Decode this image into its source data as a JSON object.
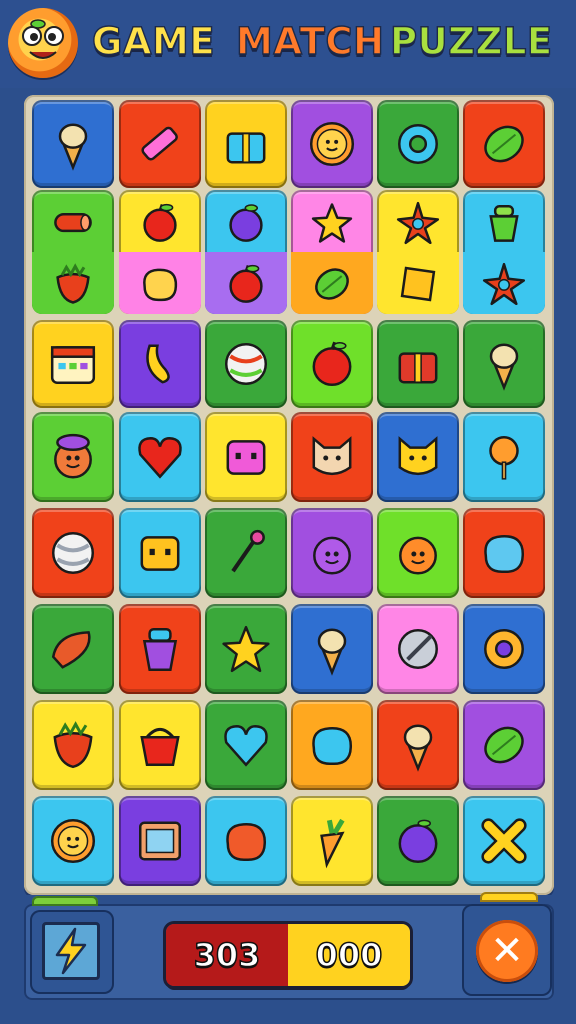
{
  "header": {
    "title_word_1": "GAME",
    "title_word_2": "MATCH",
    "title_word_3": "PUZZLE",
    "logo_icon": "smiling-sun-mascot-icon"
  },
  "board": {
    "columns": 6,
    "rows": [
      [
        {
          "color": "#2f6fd1",
          "icon": "ice-cream-cone-icon"
        },
        {
          "color": "#f0421a",
          "icon": "pencil-icon"
        },
        {
          "color": "#ffd21f",
          "icon": "gift-box-icon"
        },
        {
          "color": "#a14fe0",
          "icon": "sun-face-icon"
        },
        {
          "color": "#3aa83a",
          "icon": "donut-icon"
        },
        {
          "color": "#f0421a",
          "icon": "watermelon-icon"
        }
      ],
      [
        {
          "color": "#5ccf35",
          "split": "#5ccf35",
          "icon": "log-icon",
          "icon2": "strawberry-icon"
        },
        {
          "color": "#ffe52e",
          "split": "#ff82e6",
          "icon": "apple-icon",
          "icon2": "potato-icon"
        },
        {
          "color": "#3cc6ef",
          "split": "#a86df0",
          "icon": "plum-icon",
          "icon2": "apple-icon"
        },
        {
          "color": "#ff86e6",
          "split": "#ffa81f",
          "icon": "star-cookie-icon",
          "icon2": "leaf-icon"
        },
        {
          "color": "#ffe52e",
          "split": "#ffe52e",
          "icon": "starfish-icon",
          "icon2": "cracker-icon"
        },
        {
          "color": "#3cc6ef",
          "split": "#3cc6ef",
          "icon": "juicer-icon",
          "icon2": "spiky-fruit-icon"
        }
      ],
      [
        {
          "color": "#ffd21f",
          "icon": "calendar-icon"
        },
        {
          "color": "#7a3ee0",
          "icon": "banana-bunch-icon"
        },
        {
          "color": "#3aa83a",
          "icon": "ball-icon"
        },
        {
          "color": "#6fe02a",
          "icon": "apple-icon"
        },
        {
          "color": "#3aa83a",
          "icon": "present-icon"
        },
        {
          "color": "#3aa83a",
          "icon": "ice-cream-cone-icon"
        }
      ],
      [
        {
          "color": "#5ccf35",
          "icon": "chef-face-icon"
        },
        {
          "color": "#3cc6ef",
          "icon": "heart-icon"
        },
        {
          "color": "#ffe52e",
          "icon": "robot-face-icon"
        },
        {
          "color": "#f0421a",
          "icon": "cat-face-icon"
        },
        {
          "color": "#2f6fd1",
          "icon": "cat-face-icon"
        },
        {
          "color": "#3cc6ef",
          "icon": "lollipop-icon"
        }
      ],
      [
        {
          "color": "#f0421a",
          "icon": "beach-ball-icon"
        },
        {
          "color": "#3cc6ef",
          "icon": "robot-box-icon"
        },
        {
          "color": "#3aa83a",
          "icon": "flower-stem-icon"
        },
        {
          "color": "#a14fe0",
          "icon": "gear-face-icon"
        },
        {
          "color": "#6fe02a",
          "icon": "smiley-face-icon"
        },
        {
          "color": "#f0421a",
          "icon": "cloud-face-icon"
        }
      ],
      [
        {
          "color": "#3aa83a",
          "icon": "chili-pepper-icon"
        },
        {
          "color": "#f0421a",
          "icon": "cup-icon"
        },
        {
          "color": "#3aa83a",
          "icon": "star-icon"
        },
        {
          "color": "#2f6fd1",
          "icon": "ice-cream-cone-icon"
        },
        {
          "color": "#ff86e6",
          "icon": "compass-icon"
        },
        {
          "color": "#2f6fd1",
          "icon": "ring-icon"
        }
      ],
      [
        {
          "color": "#ffe52e",
          "icon": "strawberry-face-icon"
        },
        {
          "color": "#ffe52e",
          "icon": "basket-icon"
        },
        {
          "color": "#3aa83a",
          "icon": "heart-icon"
        },
        {
          "color": "#ffa81f",
          "icon": "blob-face-icon"
        },
        {
          "color": "#f0421a",
          "icon": "ice-cream-cone-icon"
        },
        {
          "color": "#a14fe0",
          "icon": "leaf-icon"
        }
      ],
      [
        {
          "color": "#3cc6ef",
          "icon": "sun-face-icon"
        },
        {
          "color": "#7a3ee0",
          "icon": "picture-frame-icon"
        },
        {
          "color": "#3cc6ef",
          "icon": "candy-blob-icon"
        },
        {
          "color": "#ffe52e",
          "icon": "carrot-icon"
        },
        {
          "color": "#3aa83a",
          "icon": "plum-icon"
        },
        {
          "color": "#3cc6ef",
          "icon": "x-cross-icon"
        }
      ]
    ]
  },
  "footer": {
    "power_icon": "lightning-frame-icon",
    "score_left": "303",
    "score_right": "000",
    "close_icon": "close-icon",
    "close_glyph": "✕"
  }
}
